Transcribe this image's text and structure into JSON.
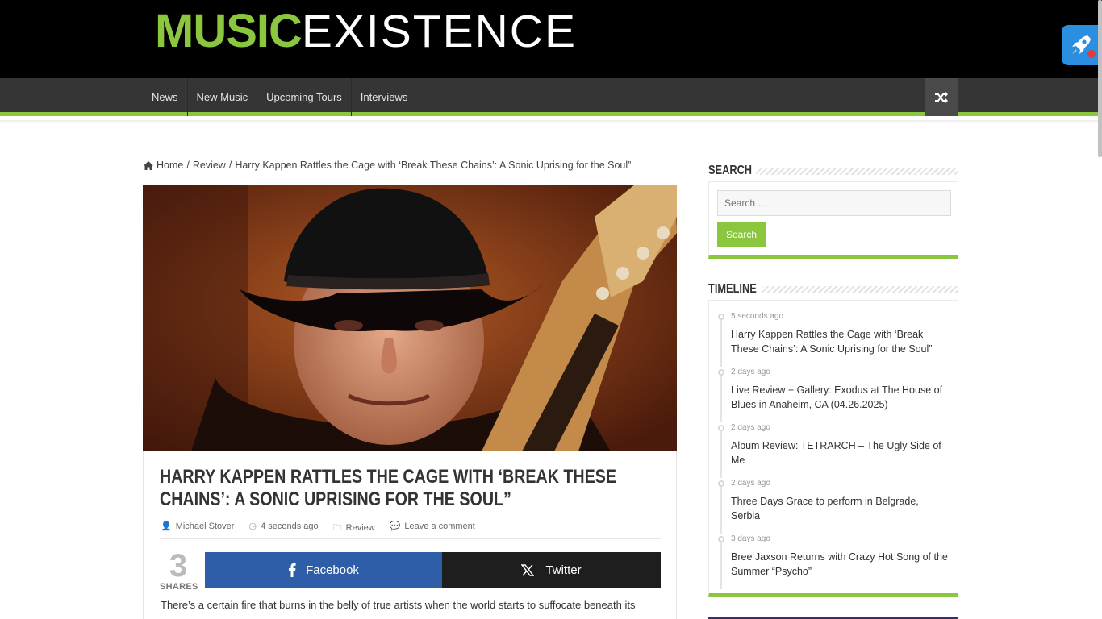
{
  "site": {
    "logo_bold": "MUSIC",
    "logo_light": "EXISTENCE"
  },
  "nav": {
    "items": [
      "News",
      "New Music",
      "Upcoming Tours",
      "Interviews"
    ]
  },
  "breadcrumb": {
    "home": "Home",
    "sep": "/",
    "section": "Review",
    "current": "Harry Kappen Rattles the Cage with ‘Break These Chains’: A Sonic Uprising for the Soul”"
  },
  "article": {
    "title": "Harry Kappen Rattles the Cage with ‘Break These Chains’: A Sonic Uprising for the Soul”",
    "author": "Michael Stover",
    "time": "4 seconds ago",
    "category": "Review",
    "comments": "Leave a comment",
    "shares_count": "3",
    "shares_label": "SHARES",
    "facebook_label": "Facebook",
    "twitter_label": "Twitter",
    "excerpt": "There’s a certain fire that burns in the belly of true artists when the world starts to suffocate beneath its"
  },
  "sidebar": {
    "search_title": "Search",
    "search_placeholder": "Search …",
    "search_button": "Search",
    "timeline_title": "Timeline",
    "timeline": [
      {
        "time": "5 seconds ago",
        "headline": "Harry Kappen Rattles the Cage with ‘Break These Chains’: A Sonic Uprising for the Soul”"
      },
      {
        "time": "2 days ago",
        "headline": "Live Review + Gallery: Exodus at The House of Blues in Anaheim, CA (04.26.2025)"
      },
      {
        "time": "2 days ago",
        "headline": "Album Review: TETRARCH – The Ugly Side of Me"
      },
      {
        "time": "2 days ago",
        "headline": "Three Days Grace to perform in Belgrade, Serbia"
      },
      {
        "time": "3 days ago",
        "headline": "Bree Jaxson Returns with Crazy Hot Song of the Summer “Psycho”"
      }
    ]
  },
  "colors": {
    "accent": "#8bc63f",
    "header_bg": "#000000",
    "nav_bg": "#353535",
    "facebook": "#2e5ea8",
    "twitter": "#1e1e1e"
  },
  "icons": [
    "home-icon",
    "shuffle-icon",
    "rocket-icon",
    "user-icon",
    "clock-icon",
    "folder-icon",
    "comments-icon",
    "facebook-icon",
    "twitter-x-icon"
  ]
}
